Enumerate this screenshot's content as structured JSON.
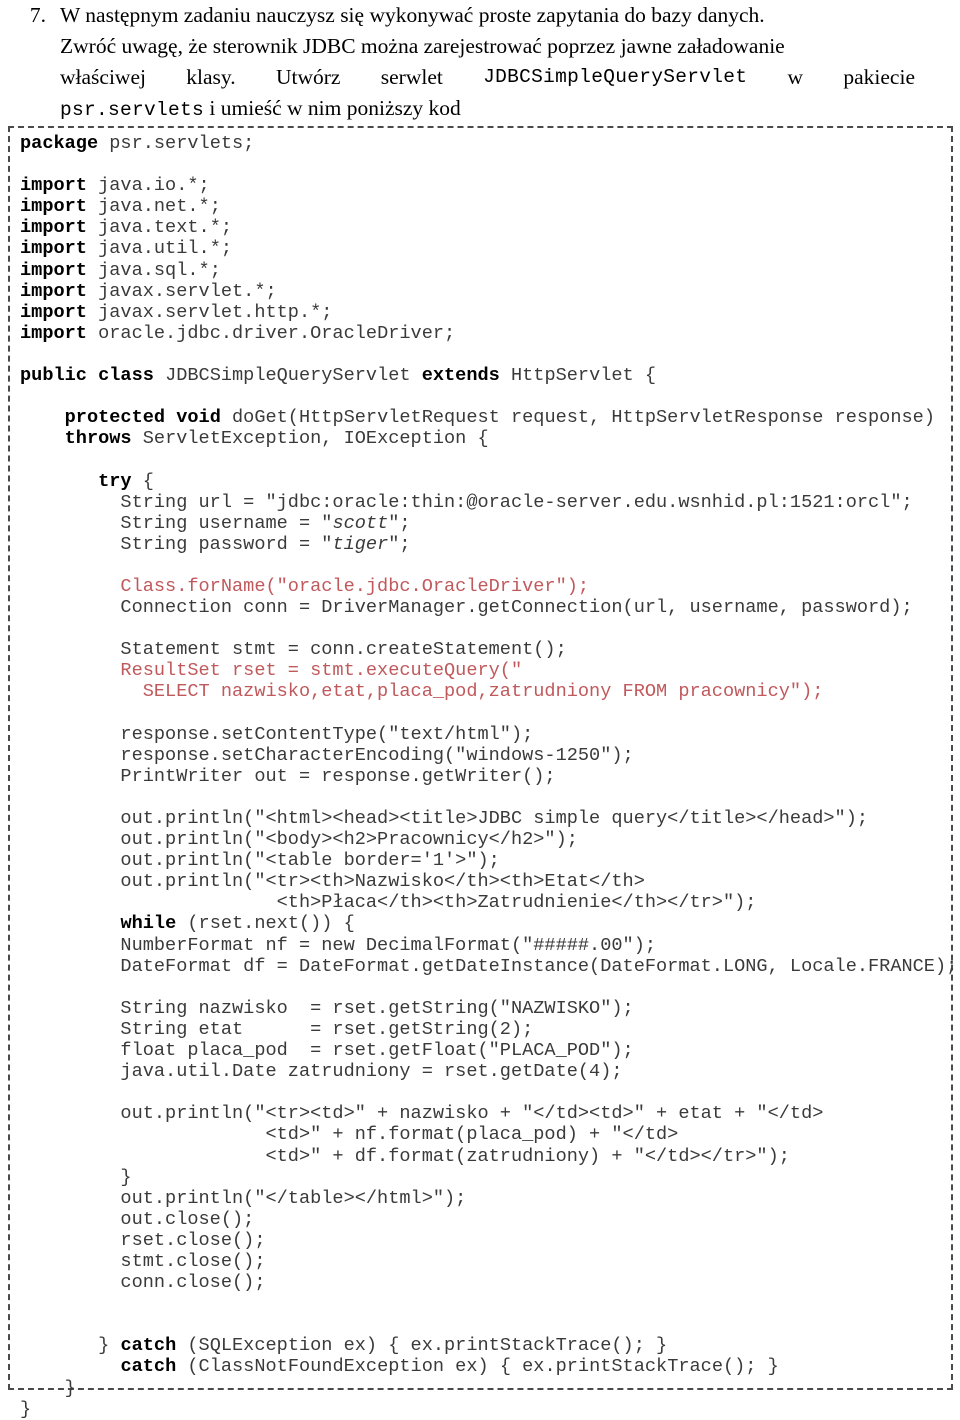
{
  "exercise": {
    "number": "7.",
    "lines": [
      {
        "type": "plain",
        "text": "W następnym zadaniu nauczysz się wykonywać proste zapytania do bazy danych."
      },
      {
        "type": "plain",
        "text": "Zwróć uwagę, że sterownik JDBC można zarejestrować poprzez jawne załadowanie"
      },
      {
        "type": "justified",
        "parts": [
          "właściwej",
          "klasy.",
          "Utwórz",
          "serwlet",
          "JDBCSimpleQueryServlet",
          "w",
          "pakiecie"
        ],
        "mono_index": 4
      },
      {
        "type": "mixed",
        "mono": "psr.servlets",
        "rest": " i umieść w nim poniższy kod"
      }
    ]
  },
  "code": {
    "language": "java",
    "lines": [
      {
        "segments": [
          {
            "t": "package",
            "s": "kw"
          },
          {
            "t": " psr.servlets;"
          }
        ]
      },
      {
        "segments": []
      },
      {
        "segments": [
          {
            "t": "import",
            "s": "kw"
          },
          {
            "t": " java.io.*;"
          }
        ]
      },
      {
        "segments": [
          {
            "t": "import",
            "s": "kw"
          },
          {
            "t": " java.net.*;"
          }
        ]
      },
      {
        "segments": [
          {
            "t": "import",
            "s": "kw"
          },
          {
            "t": " java.text.*;"
          }
        ]
      },
      {
        "segments": [
          {
            "t": "import",
            "s": "kw"
          },
          {
            "t": " java.util.*;"
          }
        ]
      },
      {
        "segments": [
          {
            "t": "import",
            "s": "kw"
          },
          {
            "t": " java.sql.*;"
          }
        ]
      },
      {
        "segments": [
          {
            "t": "import",
            "s": "kw"
          },
          {
            "t": " javax.servlet.*;"
          }
        ]
      },
      {
        "segments": [
          {
            "t": "import",
            "s": "kw"
          },
          {
            "t": " javax.servlet.http.*;"
          }
        ]
      },
      {
        "segments": [
          {
            "t": "import",
            "s": "kw"
          },
          {
            "t": " oracle.jdbc.driver.OracleDriver;"
          }
        ]
      },
      {
        "segments": []
      },
      {
        "segments": [
          {
            "t": "public class",
            "s": "kw"
          },
          {
            "t": " JDBCSimpleQueryServlet "
          },
          {
            "t": "extends",
            "s": "kw"
          },
          {
            "t": " HttpServlet {"
          }
        ]
      },
      {
        "segments": []
      },
      {
        "segments": [
          {
            "t": "    "
          },
          {
            "t": "protected void",
            "s": "kw"
          },
          {
            "t": " doGet(HttpServletRequest request, HttpServletResponse response)"
          }
        ]
      },
      {
        "segments": [
          {
            "t": "    "
          },
          {
            "t": "throws",
            "s": "kw"
          },
          {
            "t": " ServletException, IOException {"
          }
        ]
      },
      {
        "segments": []
      },
      {
        "segments": [
          {
            "t": "       "
          },
          {
            "t": "try",
            "s": "kw"
          },
          {
            "t": " {"
          }
        ]
      },
      {
        "segments": [
          {
            "t": "         String url = \"jdbc:oracle:thin:@oracle-server.edu.wsnhid.pl:1521:orcl\";"
          }
        ]
      },
      {
        "segments": [
          {
            "t": "         String username = \""
          },
          {
            "t": "scott",
            "s": "it"
          },
          {
            "t": "\";"
          }
        ]
      },
      {
        "segments": [
          {
            "t": "         String password = \""
          },
          {
            "t": "tiger",
            "s": "it"
          },
          {
            "t": "\";"
          }
        ]
      },
      {
        "segments": []
      },
      {
        "segments": [
          {
            "t": "         Class.forName(\"oracle.jdbc.OracleDriver\");",
            "s": "red"
          }
        ]
      },
      {
        "segments": [
          {
            "t": "         Connection conn = DriverManager.getConnection(url, username, password);"
          }
        ]
      },
      {
        "segments": []
      },
      {
        "segments": [
          {
            "t": "         Statement stmt = conn.createStatement();"
          }
        ]
      },
      {
        "segments": [
          {
            "t": "         ResultSet rset = stmt.executeQuery(\"",
            "s": "red"
          }
        ]
      },
      {
        "segments": [
          {
            "t": "           SELECT nazwisko,etat,placa_pod,zatrudniony FROM pracownicy\");",
            "s": "red"
          }
        ]
      },
      {
        "segments": []
      },
      {
        "segments": [
          {
            "t": "         response.setContentType(\"text/html\");"
          }
        ]
      },
      {
        "segments": [
          {
            "t": "         response.setCharacterEncoding(\"windows-1250\");"
          }
        ]
      },
      {
        "segments": [
          {
            "t": "         PrintWriter out = response.getWriter();"
          }
        ]
      },
      {
        "segments": []
      },
      {
        "segments": [
          {
            "t": "         out.println(\"<html><head><title>JDBC simple query</title></head>\");"
          }
        ]
      },
      {
        "segments": [
          {
            "t": "         out.println(\"<body><h2>Pracownicy</h2>\");"
          }
        ]
      },
      {
        "segments": [
          {
            "t": "         out.println(\"<table border='1'>\");"
          }
        ]
      },
      {
        "segments": [
          {
            "t": "         out.println(\"<tr><th>Nazwisko</th><th>Etat</th>"
          }
        ]
      },
      {
        "segments": [
          {
            "t": "                       <th>Płaca</th><th>Zatrudnienie</th></tr>\");"
          }
        ]
      },
      {
        "segments": [
          {
            "t": "         "
          },
          {
            "t": "while",
            "s": "kw"
          },
          {
            "t": " (rset.next()) {"
          }
        ]
      },
      {
        "segments": [
          {
            "t": "         NumberFormat nf = new DecimalFormat(\"#####.00\");"
          }
        ]
      },
      {
        "segments": [
          {
            "t": "         DateFormat df = DateFormat.getDateInstance(DateFormat.LONG, Locale.FRANCE);"
          }
        ]
      },
      {
        "segments": []
      },
      {
        "segments": [
          {
            "t": "         String nazwisko  = rset.getString(\"NAZWISKO\");"
          }
        ]
      },
      {
        "segments": [
          {
            "t": "         String etat      = rset.getString(2);"
          }
        ]
      },
      {
        "segments": [
          {
            "t": "         float placa_pod  = rset.getFloat(\"PLACA_POD\");"
          }
        ]
      },
      {
        "segments": [
          {
            "t": "         java.util.Date zatrudniony = rset.getDate(4);"
          }
        ]
      },
      {
        "segments": []
      },
      {
        "segments": [
          {
            "t": "         out.println(\"<tr><td>\" + nazwisko + \"</td><td>\" + etat + \"</td>"
          }
        ]
      },
      {
        "segments": [
          {
            "t": "                      <td>\" + nf.format(placa_pod) + \"</td>"
          }
        ]
      },
      {
        "segments": [
          {
            "t": "                      <td>\" + df.format(zatrudniony) + \"</td></tr>\");"
          }
        ]
      },
      {
        "segments": [
          {
            "t": "         }"
          }
        ]
      },
      {
        "segments": [
          {
            "t": "         out.println(\"</table></html>\");"
          }
        ]
      },
      {
        "segments": [
          {
            "t": "         out.close();"
          }
        ]
      },
      {
        "segments": [
          {
            "t": "         rset.close();"
          }
        ]
      },
      {
        "segments": [
          {
            "t": "         stmt.close();"
          }
        ]
      },
      {
        "segments": [
          {
            "t": "         conn.close();"
          }
        ]
      },
      {
        "segments": []
      },
      {
        "segments": []
      },
      {
        "segments": [
          {
            "t": "       } "
          },
          {
            "t": "catch",
            "s": "kw"
          },
          {
            "t": " (SQLException ex) { ex.printStackTrace(); }"
          }
        ]
      },
      {
        "segments": [
          {
            "t": "         "
          },
          {
            "t": "catch",
            "s": "kw"
          },
          {
            "t": " (ClassNotFoundException ex) { ex.printStackTrace(); }"
          }
        ]
      },
      {
        "segments": [
          {
            "t": "    }"
          }
        ]
      },
      {
        "segments": [
          {
            "t": "}"
          }
        ]
      }
    ]
  },
  "colors": {
    "text": "#000000",
    "code_text": "#3a3a3a",
    "code_highlight_red": "#c0595c",
    "box_border": "#4a4a4a",
    "background": "#ffffff"
  }
}
